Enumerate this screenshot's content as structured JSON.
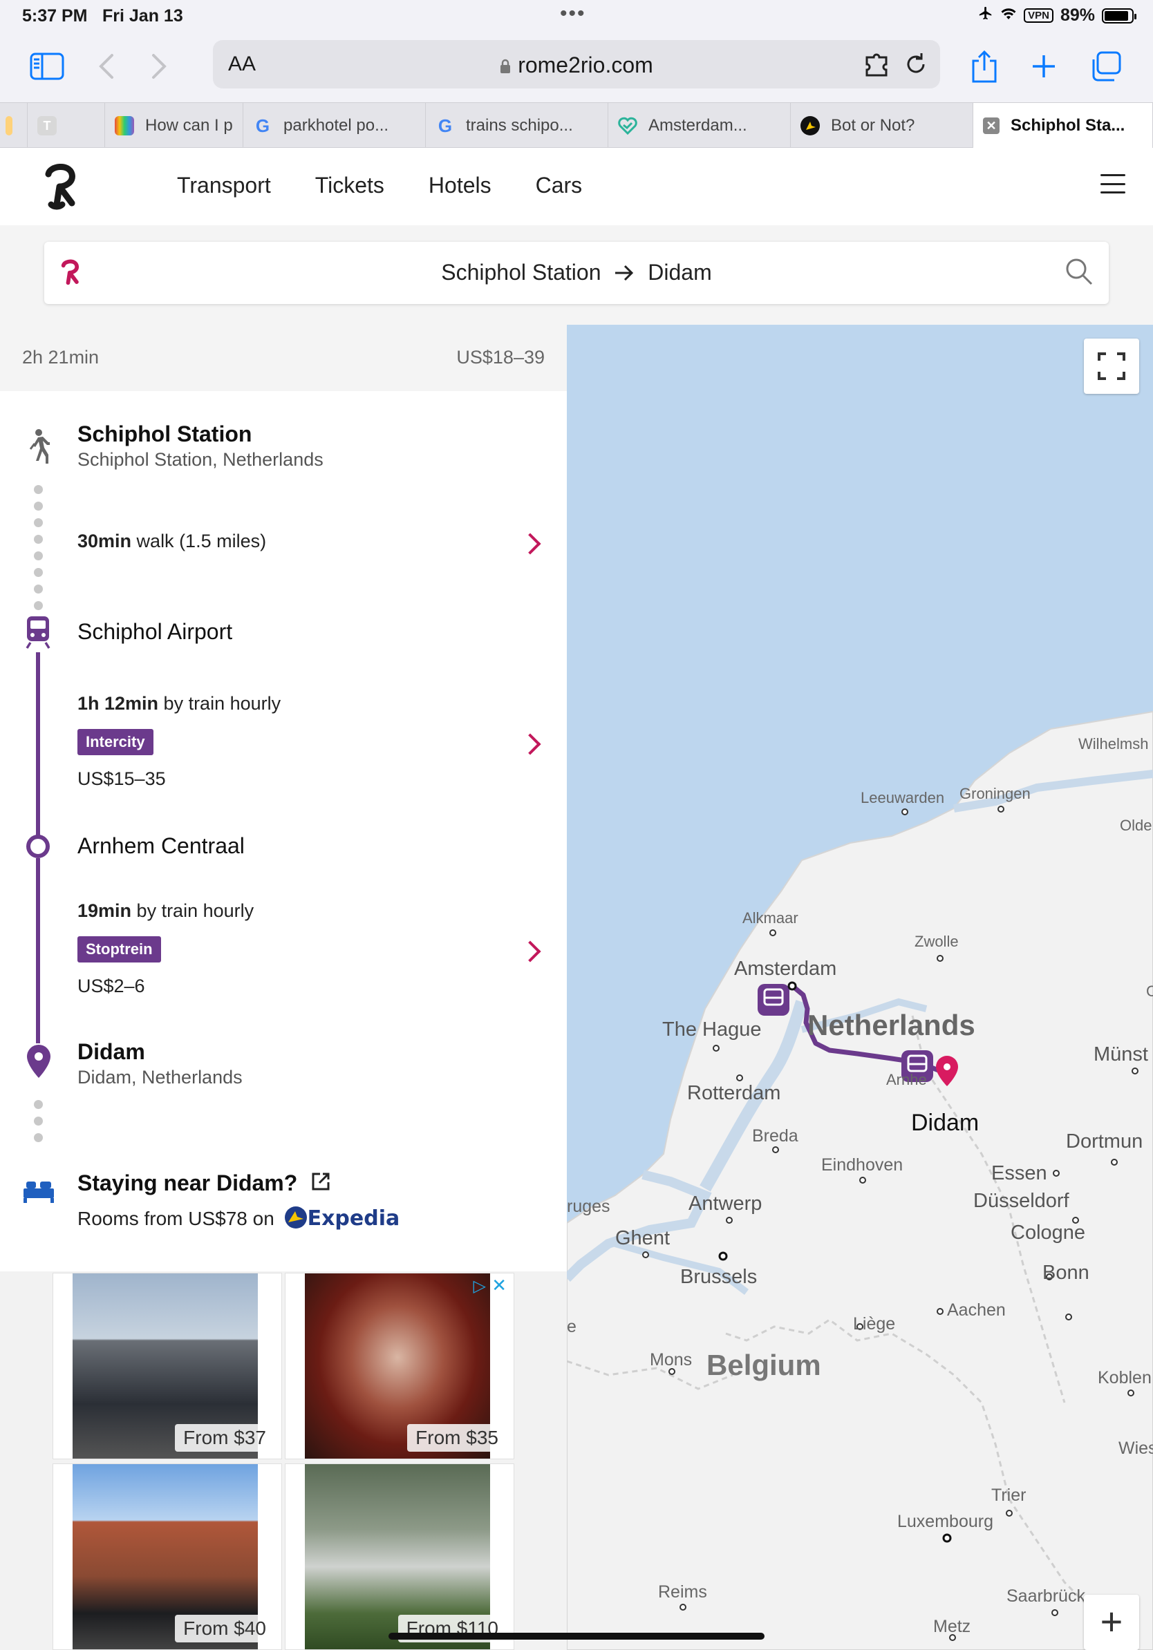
{
  "status": {
    "time": "5:37 PM",
    "date": "Fri Jan 13",
    "vpn": "VPN",
    "battery": "89%",
    "battery_level": 0.89
  },
  "browser": {
    "url_host": "rome2rio.com",
    "reader_label": "AA",
    "tabs": [
      {
        "label": "",
        "icon": "partial-tab"
      },
      {
        "label": "",
        "icon": "letter-t-tab"
      },
      {
        "label": "How can I p",
        "icon": "colorful-favicon"
      },
      {
        "label": "parkhotel po...",
        "icon": "google-icon"
      },
      {
        "label": "trains schipo...",
        "icon": "google-icon"
      },
      {
        "label": "Amsterdam...",
        "icon": "heart-check-icon"
      },
      {
        "label": "Bot or Not?",
        "icon": "plane-compass-icon"
      },
      {
        "label": "Schiphol Sta...",
        "icon": "close-tab-icon"
      }
    ]
  },
  "site": {
    "nav": [
      "Transport",
      "Tickets",
      "Hotels",
      "Cars"
    ],
    "search": {
      "from": "Schiphol Station",
      "to": "Didam"
    }
  },
  "summary": {
    "duration": "2h 21min",
    "price": "US$18–39"
  },
  "itinerary": {
    "origin": {
      "name": "Schiphol Station",
      "sub": "Schiphol Station, Netherlands"
    },
    "walk": {
      "bold": "30min",
      "text": " walk (1.5 miles)"
    },
    "stop1": {
      "name": "Schiphol Airport"
    },
    "train1": {
      "bold": "1h 12min",
      "text": " by train hourly",
      "badge": "Intercity",
      "price": "US$15–35"
    },
    "stop2": {
      "name": "Arnhem Centraal"
    },
    "train2": {
      "bold": "19min",
      "text": " by train hourly",
      "badge": "Stoptrein",
      "price": "US$2–6"
    },
    "destination": {
      "name": "Didam",
      "sub": "Didam, Netherlands"
    }
  },
  "stay": {
    "title": "Staying near Didam?",
    "sub": "Rooms from US$78 on",
    "brand": "Expedia"
  },
  "ads": [
    {
      "price": "From $37"
    },
    {
      "price": "From $35"
    },
    {
      "price": "From $40"
    },
    {
      "price": "From $110"
    }
  ],
  "map": {
    "labels": {
      "wilhelmshaven": "Wilhelmsh",
      "groningen": "Groningen",
      "leeuwarden": "Leeuwarden",
      "oldenburg": "Olde",
      "alkmaar": "Alkmaar",
      "zwolle": "Zwolle",
      "amsterdam": "Amsterdam",
      "netherlands": "Netherlands",
      "the_hague": "The Hague",
      "munster": "Münst",
      "rotterdam": "Rotterdam",
      "arnhem": "Arnhe",
      "didam": "Didam",
      "breda": "Breda",
      "dortmund": "Dortmun",
      "eindhoven": "Eindhoven",
      "essen": "Essen",
      "dusseldorf": "Düsseldorf",
      "antwerp": "Antwerp",
      "bruges": "ruges",
      "ghent": "Ghent",
      "cologne": "Cologne",
      "brussels": "Brussels",
      "bonn": "Bonn",
      "aachen": "Aachen",
      "liege": "Liège",
      "mons": "Mons",
      "belgium": "Belgium",
      "koblenz": "Koblen",
      "wiesbaden": "Wies",
      "trier": "Trier",
      "luxembourg": "Luxembourg",
      "reims": "Reims",
      "saarbrucken": "Saarbrück",
      "metz": "Metz",
      "edge_c": "C",
      "edge_e": "e"
    },
    "zoom_in": "+"
  },
  "colors": {
    "accent": "#c2185b",
    "route": "#6b3a8c",
    "link": "#0a7aff"
  }
}
